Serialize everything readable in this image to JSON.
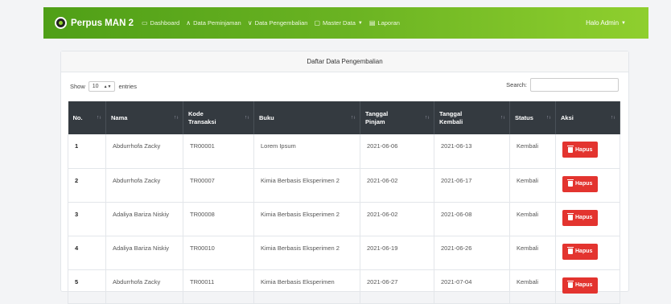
{
  "navbar": {
    "brand": "Perpus MAN 2",
    "items": [
      {
        "label": "Dashboard",
        "icon": "dashboard-icon"
      },
      {
        "label": "Data Peminjaman",
        "icon": "arrow-up-icon"
      },
      {
        "label": "Data Pengembalian",
        "icon": "arrow-down-icon"
      },
      {
        "label": "Master Data",
        "icon": "folder-icon"
      },
      {
        "label": "Laporan",
        "icon": "report-icon"
      }
    ],
    "user": "Halo Admin"
  },
  "card": {
    "title": "Daftar Data Pengembalian",
    "show_label": "Show",
    "entries_value": "10",
    "entries_label": "entries",
    "search_label": "Search:",
    "search_value": ""
  },
  "table": {
    "columns": [
      "No.",
      "Nama",
      "Kode Transaksi",
      "Buku",
      "Tanggal Pinjam",
      "Tanggal Kembali",
      "Status",
      "Aksi"
    ],
    "rows": [
      {
        "no": "1",
        "nama": "Abdurrhofa Zacky",
        "kode": "TR00001",
        "buku": "Lorem Ipsum",
        "pinjam": "2021-06-06",
        "kembali": "2021-06-13",
        "status": "Kembali",
        "aksi": "Hapus"
      },
      {
        "no": "2",
        "nama": "Abdurrhofa Zacky",
        "kode": "TR00007",
        "buku": "Kimia Berbasis Eksperimen 2",
        "pinjam": "2021-06-02",
        "kembali": "2021-06-17",
        "status": "Kembali",
        "aksi": "Hapus"
      },
      {
        "no": "3",
        "nama": "Adaliya Bariza Niskiy",
        "kode": "TR00008",
        "buku": "Kimia Berbasis Eksperimen 2",
        "pinjam": "2021-06-02",
        "kembali": "2021-06-08",
        "status": "Kembali",
        "aksi": "Hapus"
      },
      {
        "no": "4",
        "nama": "Adaliya Bariza Niskiy",
        "kode": "TR00010",
        "buku": "Kimia Berbasis Eksperimen 2",
        "pinjam": "2021-06-19",
        "kembali": "2021-06-26",
        "status": "Kembali",
        "aksi": "Hapus"
      },
      {
        "no": "5",
        "nama": "Abdurrhofa Zacky",
        "kode": "TR00011",
        "buku": "Kimia Berbasis Eksperimen",
        "pinjam": "2021-06-27",
        "kembali": "2021-07-04",
        "status": "Kembali",
        "aksi": "Hapus"
      }
    ]
  },
  "colors": {
    "nav_start": "#4f9f17",
    "nav_end": "#8fcf2e",
    "table_header": "#343a40",
    "danger": "#e3342f"
  }
}
